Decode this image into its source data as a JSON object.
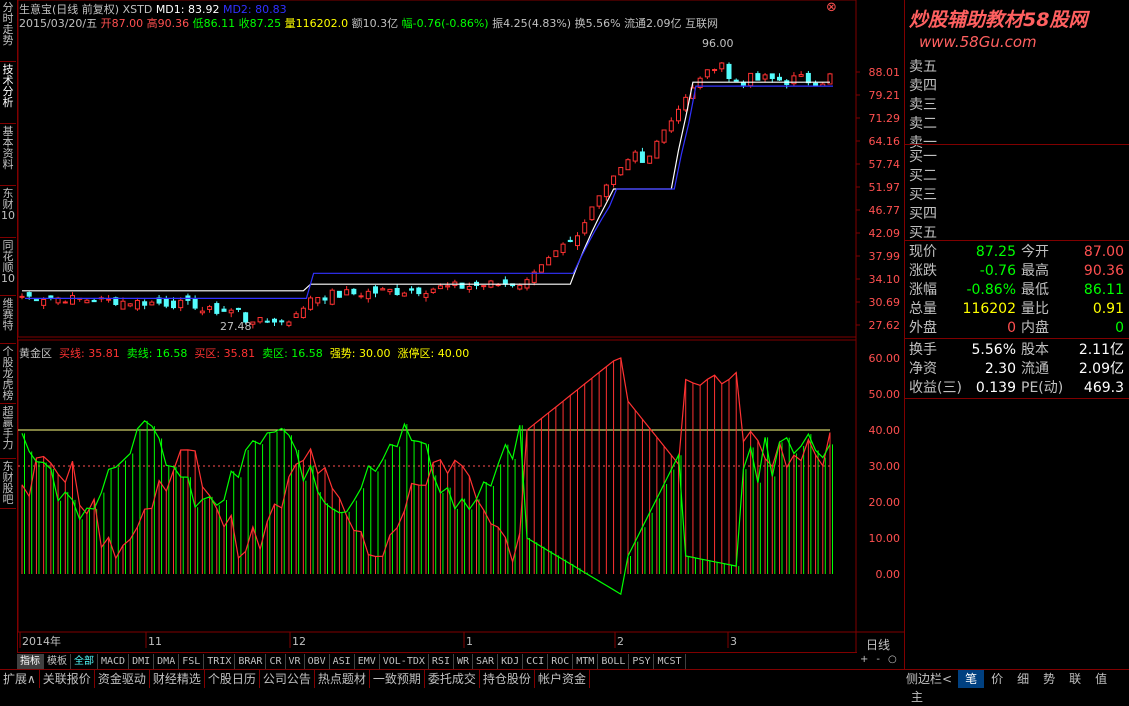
{
  "left_tabs": [
    "分时走势",
    "技术分析",
    "基本资料",
    "东财10",
    "同花顺10",
    "维赛特",
    "个股龙虎榜",
    "超赢手力",
    "东财股吧"
  ],
  "header": {
    "stock": "生意宝(日线 前复权)",
    "xstd": "XSTD",
    "md1": "MD1: 83.92",
    "md2": "MD2: 80.83",
    "date": "2015/03/20/五",
    "open": "开87.00",
    "high": "高90.36",
    "low": "低86.11",
    "close": "收87.25",
    "vol": "量116202.0",
    "amount": "额10.3亿",
    "change": "幅-0.76(-0.86%)",
    "amp": "振4.25(4.83%)",
    "turnover": "换5.56%",
    "float": "流通2.09亿",
    "net": "互联网"
  },
  "annotations": {
    "high_mark": "96.00",
    "low_mark": "27.48"
  },
  "price_axis": [
    "88.01",
    "79.21",
    "71.29",
    "64.16",
    "57.74",
    "51.97",
    "46.77",
    "42.09",
    "37.99",
    "34.10",
    "30.69",
    "27.62"
  ],
  "indicator_header": {
    "name": "黄金区",
    "buy_line": "买线: 35.81",
    "sell_line": "卖线: 16.58",
    "buy_zone": "买区: 35.81",
    "sell_zone": "卖区: 16.58",
    "strong": "强势: 30.00",
    "limit": "涨停区: 40.00"
  },
  "indicator_axis": [
    "60.00",
    "50.00",
    "40.00",
    "30.00",
    "20.00",
    "10.00",
    "0.00"
  ],
  "time_axis": [
    "2014年",
    "11",
    "12",
    "1",
    "2",
    "3"
  ],
  "period": "日线",
  "zoom_buttons": [
    "+",
    "-",
    "○"
  ],
  "watermark": {
    "title": "炒股辅助教材58股网",
    "url": "www.58Gu.com"
  },
  "order_book": {
    "sell": [
      "卖五",
      "卖四",
      "卖三",
      "卖二",
      "卖一"
    ],
    "buy": [
      "买一",
      "买二",
      "买三",
      "买四",
      "买五"
    ]
  },
  "quote": [
    {
      "l1": "现价",
      "v1": "87.25",
      "l2": "今开",
      "v2": "87.00"
    },
    {
      "l1": "涨跌",
      "v1": "-0.76",
      "l2": "最高",
      "v2": "90.36"
    },
    {
      "l1": "涨幅",
      "v1": "-0.86%",
      "l2": "最低",
      "v2": "86.11"
    },
    {
      "l1": "总量",
      "v1": "116202",
      "l2": "量比",
      "v2": "0.91"
    },
    {
      "l1": "外盘",
      "v1": "0",
      "l2": "内盘",
      "v2": "0"
    }
  ],
  "fund": [
    {
      "l1": "换手",
      "v1": "5.56%",
      "l2": "股本",
      "v2": "2.11亿"
    },
    {
      "l1": "净资",
      "v1": "2.30",
      "l2": "流通",
      "v2": "2.09亿"
    },
    {
      "l1": "收益(三)",
      "v1": "0.139",
      "l2": "PE(动)",
      "v2": "469.3"
    }
  ],
  "indicator_tabs": [
    "指标",
    "模板",
    "全部",
    "MACD",
    "DMI",
    "DMA",
    "FSL",
    "TRIX",
    "BRAR",
    "CR",
    "VR",
    "OBV",
    "ASI",
    "EMV",
    "VOL-TDX",
    "RSI",
    "WR",
    "SAR",
    "KDJ",
    "CCI",
    "ROC",
    "MTM",
    "BOLL",
    "PSY",
    "MCST"
  ],
  "bottom_tabs": [
    "扩展∧",
    "关联报价",
    "资金驱动",
    "财经精选",
    "个股日历",
    "公司公告",
    "热点题材",
    "一致预期",
    "委托成交",
    "持仓股份",
    "帐户资金"
  ],
  "right_bottom_tabs": [
    "侧边栏<",
    "笔",
    "价",
    "细",
    "势",
    "联",
    "值",
    "主"
  ],
  "colors": {
    "up": "#ff3232",
    "down": "#54fcfc",
    "buyline": "#ff3232",
    "sellline": "#00ff00",
    "bg": "#000000",
    "grid": "#800000",
    "label": "#c0c0c0",
    "watermark": "#ff6060"
  }
}
